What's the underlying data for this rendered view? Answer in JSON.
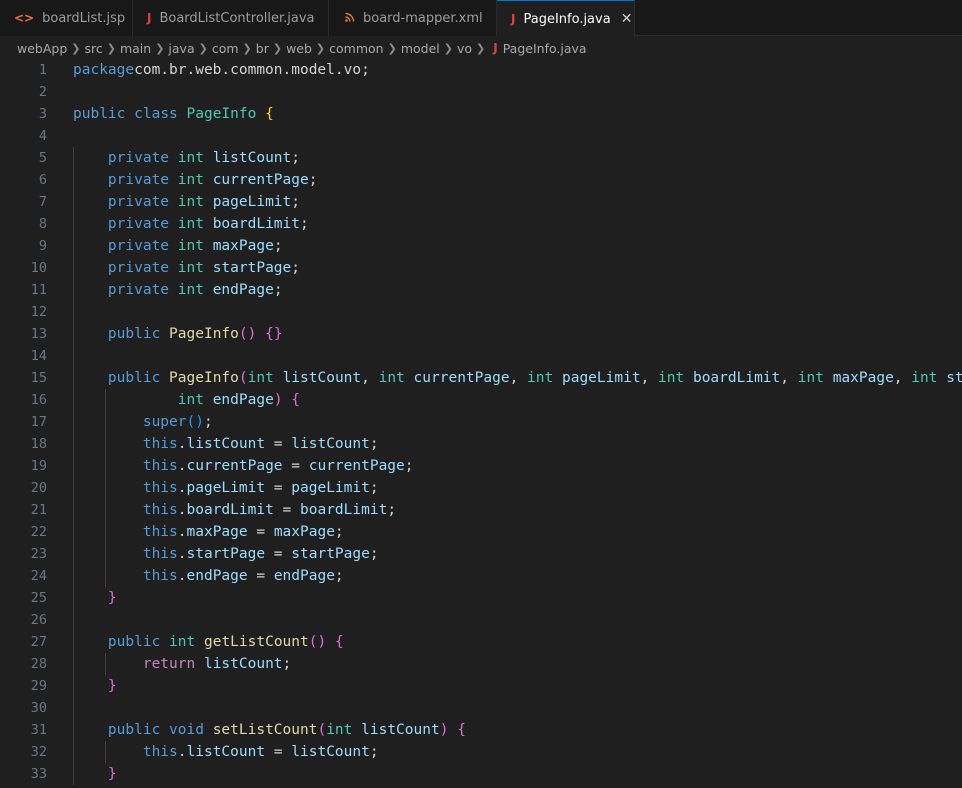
{
  "tabs": [
    {
      "label": "boardList.jsp",
      "icon": "<>",
      "icon_color": "#e37933",
      "active": false
    },
    {
      "label": "BoardListController.java",
      "icon": "J",
      "icon_color": "#e04040",
      "active": false
    },
    {
      "label": "board-mapper.xml",
      "icon": "rss",
      "icon_color": "#e37933",
      "active": false
    },
    {
      "label": "PageInfo.java",
      "icon": "J",
      "icon_color": "#e04040",
      "active": true,
      "close": "✕"
    }
  ],
  "breadcrumb": [
    "webApp",
    "src",
    "main",
    "java",
    "com",
    "br",
    "web",
    "common",
    "model",
    "vo",
    "PageInfo.java"
  ],
  "colors": {
    "keyword": "#569cd6",
    "type": "#4ec9b0",
    "variable": "#9cdcfe",
    "function": "#dcdcaa",
    "control": "#c586c0",
    "bracket1": "#ffd700",
    "bracket2": "#da70d6",
    "bracket3": "#179fff",
    "line_number": "#6e7681",
    "accent": "#0078d4"
  },
  "code": [
    {
      "n": "1",
      "t": [
        [
          "kw",
          "package"
        ],
        [
          "",
          "com.br.web.common.model.vo;"
        ]
      ]
    },
    {
      "n": "2",
      "t": []
    },
    {
      "n": "3",
      "t": [
        [
          "kw",
          "public"
        ],
        [
          "",
          " "
        ],
        [
          "kw",
          "class"
        ],
        [
          "",
          " "
        ],
        [
          "ty",
          "PageInfo"
        ],
        [
          "",
          " "
        ],
        [
          "b1",
          "{"
        ]
      ]
    },
    {
      "n": "4",
      "t": []
    },
    {
      "n": "5",
      "t": [
        [
          "",
          "    "
        ],
        [
          "kw",
          "private"
        ],
        [
          "",
          " "
        ],
        [
          "ty",
          "int"
        ],
        [
          "",
          " "
        ],
        [
          "vr",
          "listCount"
        ],
        [
          "",
          ";"
        ]
      ]
    },
    {
      "n": "6",
      "t": [
        [
          "",
          "    "
        ],
        [
          "kw",
          "private"
        ],
        [
          "",
          " "
        ],
        [
          "ty",
          "int"
        ],
        [
          "",
          " "
        ],
        [
          "vr",
          "currentPage"
        ],
        [
          "",
          ";"
        ]
      ]
    },
    {
      "n": "7",
      "t": [
        [
          "",
          "    "
        ],
        [
          "kw",
          "private"
        ],
        [
          "",
          " "
        ],
        [
          "ty",
          "int"
        ],
        [
          "",
          " "
        ],
        [
          "vr",
          "pageLimit"
        ],
        [
          "",
          ";"
        ]
      ]
    },
    {
      "n": "8",
      "t": [
        [
          "",
          "    "
        ],
        [
          "kw",
          "private"
        ],
        [
          "",
          " "
        ],
        [
          "ty",
          "int"
        ],
        [
          "",
          " "
        ],
        [
          "vr",
          "boardLimit"
        ],
        [
          "",
          ";"
        ]
      ]
    },
    {
      "n": "9",
      "t": [
        [
          "",
          "    "
        ],
        [
          "kw",
          "private"
        ],
        [
          "",
          " "
        ],
        [
          "ty",
          "int"
        ],
        [
          "",
          " "
        ],
        [
          "vr",
          "maxPage"
        ],
        [
          "",
          ";"
        ]
      ]
    },
    {
      "n": "10",
      "t": [
        [
          "",
          "    "
        ],
        [
          "kw",
          "private"
        ],
        [
          "",
          " "
        ],
        [
          "ty",
          "int"
        ],
        [
          "",
          " "
        ],
        [
          "vr",
          "startPage"
        ],
        [
          "",
          ";"
        ]
      ]
    },
    {
      "n": "11",
      "t": [
        [
          "",
          "    "
        ],
        [
          "kw",
          "private"
        ],
        [
          "",
          " "
        ],
        [
          "ty",
          "int"
        ],
        [
          "",
          " "
        ],
        [
          "vr",
          "endPage"
        ],
        [
          "",
          ";"
        ]
      ]
    },
    {
      "n": "12",
      "t": []
    },
    {
      "n": "13",
      "t": [
        [
          "",
          "    "
        ],
        [
          "kw",
          "public"
        ],
        [
          "",
          " "
        ],
        [
          "fn",
          "PageInfo"
        ],
        [
          "b2",
          "()"
        ],
        [
          "",
          " "
        ],
        [
          "b2",
          "{}"
        ]
      ]
    },
    {
      "n": "14",
      "t": []
    },
    {
      "n": "15",
      "t": [
        [
          "",
          "    "
        ],
        [
          "kw",
          "public"
        ],
        [
          "",
          " "
        ],
        [
          "fn",
          "PageInfo"
        ],
        [
          "b2",
          "("
        ],
        [
          "ty",
          "int"
        ],
        [
          "",
          " "
        ],
        [
          "vr",
          "listCount"
        ],
        [
          "",
          ", "
        ],
        [
          "ty",
          "int"
        ],
        [
          "",
          " "
        ],
        [
          "vr",
          "currentPage"
        ],
        [
          "",
          ", "
        ],
        [
          "ty",
          "int"
        ],
        [
          "",
          " "
        ],
        [
          "vr",
          "pageLimit"
        ],
        [
          "",
          ", "
        ],
        [
          "ty",
          "int"
        ],
        [
          "",
          " "
        ],
        [
          "vr",
          "boardLimit"
        ],
        [
          "",
          ", "
        ],
        [
          "ty",
          "int"
        ],
        [
          "",
          " "
        ],
        [
          "vr",
          "maxPage"
        ],
        [
          "",
          ", "
        ],
        [
          "ty",
          "int"
        ],
        [
          "",
          " "
        ],
        [
          "vr",
          "startPage"
        ],
        [
          "",
          ","
        ]
      ]
    },
    {
      "n": "16",
      "t": [
        [
          "",
          "            "
        ],
        [
          "ty",
          "int"
        ],
        [
          "",
          " "
        ],
        [
          "vr",
          "endPage"
        ],
        [
          "b2",
          ")"
        ],
        [
          "",
          " "
        ],
        [
          "b2",
          "{"
        ]
      ]
    },
    {
      "n": "17",
      "t": [
        [
          "",
          "        "
        ],
        [
          "kw",
          "super"
        ],
        [
          "b3",
          "()"
        ],
        [
          "",
          ";"
        ]
      ]
    },
    {
      "n": "18",
      "t": [
        [
          "",
          "        "
        ],
        [
          "kw",
          "this"
        ],
        [
          "",
          "."
        ],
        [
          "vr",
          "listCount"
        ],
        [
          "",
          " = "
        ],
        [
          "vr",
          "listCount"
        ],
        [
          "",
          ";"
        ]
      ]
    },
    {
      "n": "19",
      "t": [
        [
          "",
          "        "
        ],
        [
          "kw",
          "this"
        ],
        [
          "",
          "."
        ],
        [
          "vr",
          "currentPage"
        ],
        [
          "",
          " = "
        ],
        [
          "vr",
          "currentPage"
        ],
        [
          "",
          ";"
        ]
      ]
    },
    {
      "n": "20",
      "t": [
        [
          "",
          "        "
        ],
        [
          "kw",
          "this"
        ],
        [
          "",
          "."
        ],
        [
          "vr",
          "pageLimit"
        ],
        [
          "",
          " = "
        ],
        [
          "vr",
          "pageLimit"
        ],
        [
          "",
          ";"
        ]
      ]
    },
    {
      "n": "21",
      "t": [
        [
          "",
          "        "
        ],
        [
          "kw",
          "this"
        ],
        [
          "",
          "."
        ],
        [
          "vr",
          "boardLimit"
        ],
        [
          "",
          " = "
        ],
        [
          "vr",
          "boardLimit"
        ],
        [
          "",
          ";"
        ]
      ]
    },
    {
      "n": "22",
      "t": [
        [
          "",
          "        "
        ],
        [
          "kw",
          "this"
        ],
        [
          "",
          "."
        ],
        [
          "vr",
          "maxPage"
        ],
        [
          "",
          " = "
        ],
        [
          "vr",
          "maxPage"
        ],
        [
          "",
          ";"
        ]
      ]
    },
    {
      "n": "23",
      "t": [
        [
          "",
          "        "
        ],
        [
          "kw",
          "this"
        ],
        [
          "",
          "."
        ],
        [
          "vr",
          "startPage"
        ],
        [
          "",
          " = "
        ],
        [
          "vr",
          "startPage"
        ],
        [
          "",
          ";"
        ]
      ]
    },
    {
      "n": "24",
      "t": [
        [
          "",
          "        "
        ],
        [
          "kw",
          "this"
        ],
        [
          "",
          "."
        ],
        [
          "vr",
          "endPage"
        ],
        [
          "",
          " = "
        ],
        [
          "vr",
          "endPage"
        ],
        [
          "",
          ";"
        ]
      ]
    },
    {
      "n": "25",
      "t": [
        [
          "",
          "    "
        ],
        [
          "b2",
          "}"
        ]
      ]
    },
    {
      "n": "26",
      "t": []
    },
    {
      "n": "27",
      "t": [
        [
          "",
          "    "
        ],
        [
          "kw",
          "public"
        ],
        [
          "",
          " "
        ],
        [
          "ty",
          "int"
        ],
        [
          "",
          " "
        ],
        [
          "fn",
          "getListCount"
        ],
        [
          "b2",
          "()"
        ],
        [
          "",
          " "
        ],
        [
          "b2",
          "{"
        ]
      ]
    },
    {
      "n": "28",
      "t": [
        [
          "",
          "        "
        ],
        [
          "ctl",
          "return"
        ],
        [
          "",
          " "
        ],
        [
          "vr",
          "listCount"
        ],
        [
          "",
          ";"
        ]
      ]
    },
    {
      "n": "29",
      "t": [
        [
          "",
          "    "
        ],
        [
          "b2",
          "}"
        ]
      ]
    },
    {
      "n": "30",
      "t": []
    },
    {
      "n": "31",
      "t": [
        [
          "",
          "    "
        ],
        [
          "kw",
          "public"
        ],
        [
          "",
          " "
        ],
        [
          "kw",
          "void"
        ],
        [
          "",
          " "
        ],
        [
          "fn",
          "setListCount"
        ],
        [
          "b2",
          "("
        ],
        [
          "ty",
          "int"
        ],
        [
          "",
          " "
        ],
        [
          "vr",
          "listCount"
        ],
        [
          "b2",
          ")"
        ],
        [
          "",
          " "
        ],
        [
          "b2",
          "{"
        ]
      ]
    },
    {
      "n": "32",
      "t": [
        [
          "",
          "        "
        ],
        [
          "kw",
          "this"
        ],
        [
          "",
          "."
        ],
        [
          "vr",
          "listCount"
        ],
        [
          "",
          " = "
        ],
        [
          "vr",
          "listCount"
        ],
        [
          "",
          ";"
        ]
      ]
    },
    {
      "n": "33",
      "t": [
        [
          "",
          "    "
        ],
        [
          "b2",
          "}"
        ]
      ]
    }
  ]
}
